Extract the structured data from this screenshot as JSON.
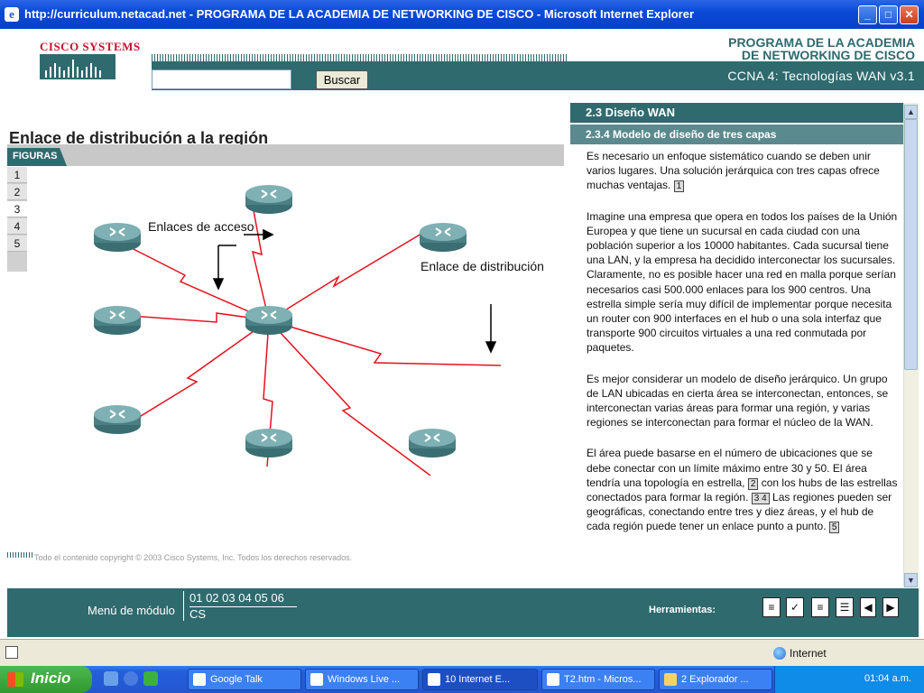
{
  "window": {
    "title": "http://curriculum.netacad.net - PROGRAMA DE LA ACADEMIA DE NETWORKING DE CISCO - Microsoft Internet Explorer"
  },
  "header": {
    "logo_text": "CISCO SYSTEMS",
    "program_line1": "PROGRAMA DE LA ACADEMIA",
    "program_line2": "DE NETWORKING DE CISCO",
    "course": "CCNA 4: Tecnologías WAN v3.1",
    "search_button": "Buscar",
    "search_value": ""
  },
  "slide": {
    "title": "Enlace de distribución a la región",
    "figures_tab": "FIGURAS",
    "figure_numbers": [
      "1",
      "2",
      "3",
      "4",
      "5"
    ],
    "active_figure": "3"
  },
  "figure": {
    "label_access": "Enlaces de acceso",
    "label_distribution": "Enlace de distribución"
  },
  "copyright": "Todo el contenido copyright © 2003 Cisco Systems, Inc. Todos los derechos reservados.",
  "panel": {
    "section": "2.3    Diseño WAN",
    "subsection": "2.3.4 Modelo de diseño de tres capas",
    "p1": "Es necesario un enfoque sistemático cuando se deben unir varios lugares. Una solución jerárquica con tres capas ofrece muchas ventajas.",
    "p1_link": "1",
    "p2": "Imagine una empresa que opera en todos los países de la Unión Europea y que tiene un sucursal en cada ciudad con una población superior a los 10000 habitantes. Cada sucursal tiene una LAN, y la empresa ha decidido interconectar los sucursales. Claramente, no es posible hacer una red en malla porque serían necesarios casi 500.000 enlaces para los 900 centros. Una estrella simple sería muy difícil de implementar porque necesita un router con 900 interfaces en el hub o una sola interfaz que transporte 900 circuitos virtuales a una red conmutada por paquetes.",
    "p3": "Es mejor considerar un modelo de diseño jerárquico. Un grupo de LAN ubicadas en cierta área se interconectan, entonces, se interconectan varias áreas para formar una región, y varias regiones se interconectan para formar el núcleo de la WAN.",
    "p4a": "El área puede basarse en el número de ubicaciones que se debe conectar con un límite máximo entre 30 y 50. El área tendría una topología en estrella,",
    "p4_link1": "2",
    "p4b": "con los hubs de las estrellas conectados para formar la región.",
    "p4_link2": "3 4",
    "p4c": "Las regiones pueden ser geográficas, conectando entre tres y diez áreas, y el hub de cada región puede tener un enlace punto a punto.",
    "p4_link3": "5"
  },
  "footer": {
    "menu_label": "Menú de módulo",
    "modules": "01 02 03 04 05 06",
    "cs": "CS",
    "tools_label": "Herramientas:"
  },
  "statusbar": {
    "zone": "Internet"
  },
  "taskbar": {
    "start": "Inicio",
    "items": [
      "Google Talk",
      "Windows Live ...",
      "10 Internet E...",
      "T2.htm - Micros...",
      "2 Explorador ..."
    ],
    "clock": "01:04 a.m."
  }
}
